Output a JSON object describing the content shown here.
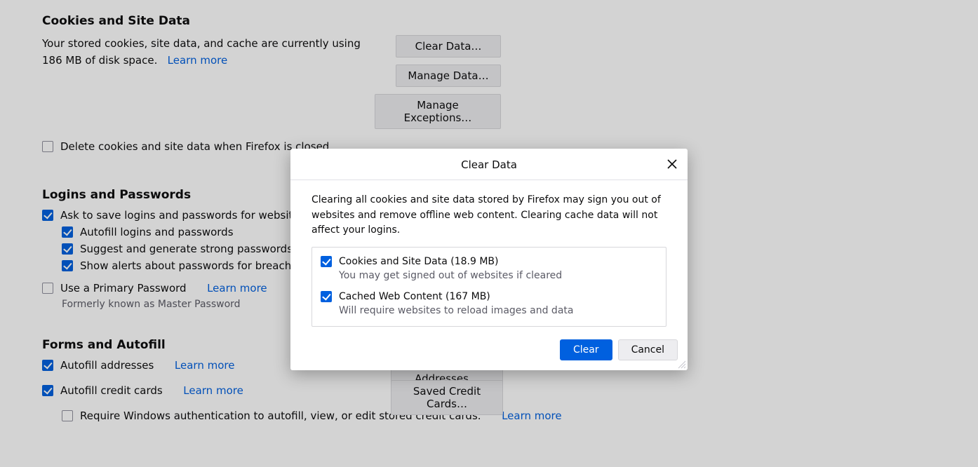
{
  "cookies": {
    "header": "Cookies and Site Data",
    "desc_a": "Your stored cookies, site data, and cache are currently using 186 MB of disk space.",
    "learn_more": "Learn more",
    "delete_on_close": "Delete cookies and site data when Firefox is closed",
    "clear_data_btn": "Clear Data…",
    "manage_data_btn": "Manage Data…",
    "manage_exceptions_btn": "Manage Exceptions…"
  },
  "logins": {
    "header": "Logins and Passwords",
    "ask_save": "Ask to save logins and passwords for websites",
    "autofill": "Autofill logins and passwords",
    "suggest": "Suggest and generate strong passwords",
    "alerts": "Show alerts about passwords for breached websites",
    "primary_pw": "Use a Primary Password",
    "primary_learn": "Learn more",
    "primary_note": "Formerly known as Master Password"
  },
  "forms": {
    "header": "Forms and Autofill",
    "addresses": "Autofill addresses",
    "addresses_learn": "Learn more",
    "saved_addresses_btn": "Saved Addresses…",
    "cards": "Autofill credit cards",
    "cards_learn": "Learn more",
    "saved_cards_btn": "Saved Credit Cards…",
    "win_auth": "Require Windows authentication to autofill, view, or edit stored credit cards.",
    "win_auth_learn": "Learn more"
  },
  "dialog": {
    "title": "Clear Data",
    "desc": "Clearing all cookies and site data stored by Firefox may sign you out of websites and remove offline web content. Clearing cache data will not affect your logins.",
    "opt1_label": "Cookies and Site Data (18.9 MB)",
    "opt1_sub": "You may get signed out of websites if cleared",
    "opt2_label": "Cached Web Content (167 MB)",
    "opt2_sub": "Will require websites to reload images and data",
    "clear_btn": "Clear",
    "cancel_btn": "Cancel"
  }
}
